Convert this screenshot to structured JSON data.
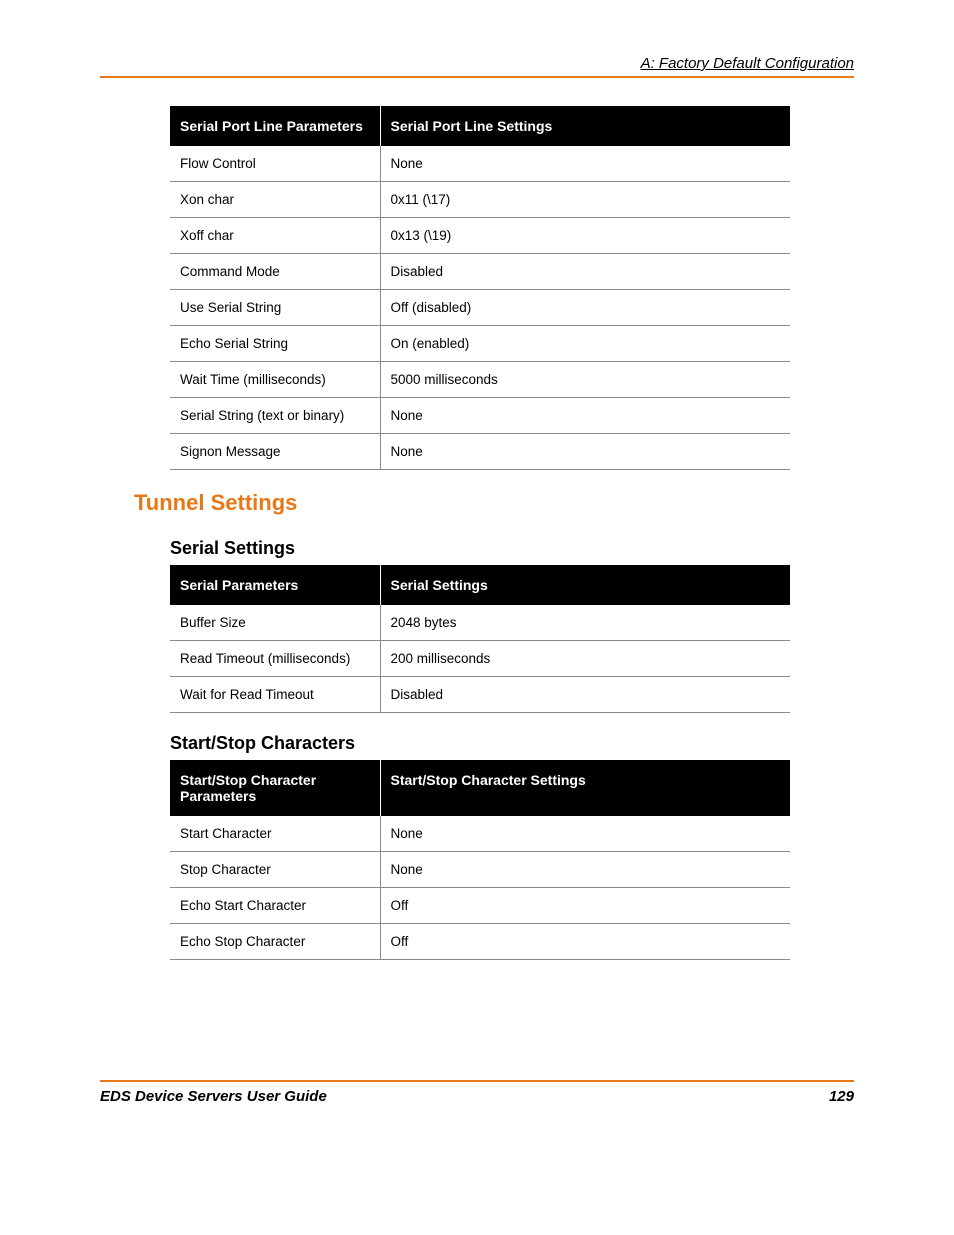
{
  "header": {
    "appendix": "A: Factory Default Configuration"
  },
  "table1": {
    "head_param": "Serial Port Line Parameters",
    "head_value": "Serial Port Line Settings",
    "rows": [
      {
        "param": "Flow Control",
        "value": "None"
      },
      {
        "param": "Xon char",
        "value": "0x11 (\\17)"
      },
      {
        "param": "Xoff char",
        "value": "0x13 (\\19)"
      },
      {
        "param": "Command Mode",
        "value": "Disabled"
      },
      {
        "param": "Use Serial String",
        "value": "Off (disabled)"
      },
      {
        "param": "Echo Serial String",
        "value": "On (enabled)"
      },
      {
        "param": "Wait Time (milliseconds)",
        "value": "5000 milliseconds"
      },
      {
        "param": "Serial String (text or binary)",
        "value": "None"
      },
      {
        "param": "Signon Message",
        "value": "None"
      }
    ]
  },
  "section_title": "Tunnel Settings",
  "subsection1": {
    "title": "Serial Settings",
    "head_param": "Serial Parameters",
    "head_value": "Serial Settings",
    "rows": [
      {
        "param": "Buffer Size",
        "value": "2048 bytes"
      },
      {
        "param": "Read Timeout (milliseconds)",
        "value": "200 milliseconds"
      },
      {
        "param": "Wait for Read Timeout",
        "value": "Disabled"
      }
    ]
  },
  "subsection2": {
    "title": "Start/Stop Characters",
    "head_param": "Start/Stop Character Parameters",
    "head_value": "Start/Stop Character Settings",
    "rows": [
      {
        "param": "Start Character",
        "value": "None"
      },
      {
        "param": "Stop Character",
        "value": "None"
      },
      {
        "param": "Echo Start Character",
        "value": "Off"
      },
      {
        "param": "Echo Stop Character",
        "value": "Off"
      }
    ]
  },
  "footer": {
    "guide": "EDS Device Servers User Guide",
    "page": "129"
  }
}
